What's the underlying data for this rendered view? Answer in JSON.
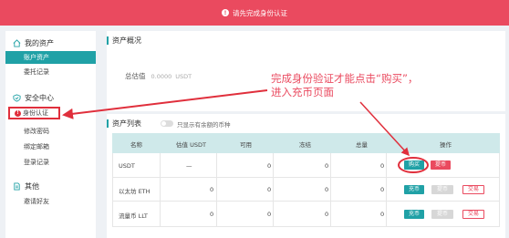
{
  "banner": {
    "icon": "alert-icon",
    "text": "请先完成身份认证"
  },
  "sidebar": {
    "asset_group": {
      "icon": "home-icon",
      "label": "我的资产"
    },
    "asset_items": [
      {
        "label": "账户资产",
        "active": true
      },
      {
        "label": "委托记录",
        "active": false
      }
    ],
    "security_group": {
      "icon": "shield-icon",
      "label": "安全中心"
    },
    "security_items": [
      {
        "label": "身份认证",
        "icon": "alert-icon"
      },
      {
        "label": "修改密码"
      },
      {
        "label": "绑定邮箱"
      },
      {
        "label": "登录记录"
      }
    ],
    "other_group": {
      "icon": "document-icon",
      "label": "其他"
    },
    "other_items": [
      {
        "label": "邀请好友"
      }
    ]
  },
  "overview": {
    "title": "资产概况",
    "total_label": "总估值",
    "total_value": "0.0000",
    "total_unit": "USDT"
  },
  "annotation": {
    "line1": "完成身份验证才能点击“购买”，",
    "line2": "进入充币页面"
  },
  "asset_list": {
    "title": "资产列表",
    "toggle_label": "只显示有余额的币种",
    "columns": [
      "名称",
      "估值 USDT",
      "可用",
      "冻结",
      "总量",
      "操作"
    ],
    "rows": [
      {
        "name": "USDT",
        "valuation": "—",
        "available": "0",
        "frozen": "0",
        "total": "0",
        "actions": [
          "购买",
          "提币"
        ]
      },
      {
        "name": "以太坊 ETH",
        "valuation": "0",
        "available": "0",
        "frozen": "0",
        "total": "0",
        "actions": [
          "充币",
          "提币",
          "交易"
        ]
      },
      {
        "name": "流量币 LLT",
        "valuation": "0",
        "available": "0",
        "frozen": "0",
        "total": "0",
        "actions": [
          "充币",
          "提币",
          "交易"
        ]
      }
    ]
  },
  "colors": {
    "accent": "#20a1a6",
    "alert": "#ea4a5f",
    "annotation": "#e02f3c"
  }
}
